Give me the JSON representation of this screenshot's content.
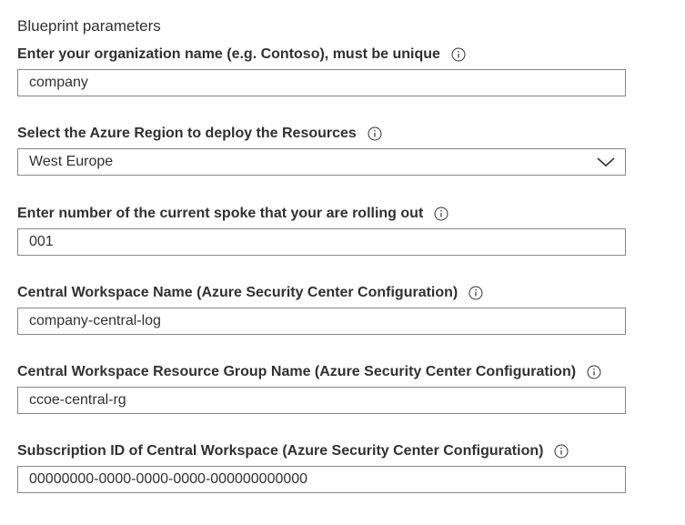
{
  "section": {
    "title": "Blueprint parameters"
  },
  "fields": [
    {
      "label": "Enter your organization name (e.g. Contoso), must be unique",
      "value": "company",
      "kind": "text"
    },
    {
      "label": "Select the Azure Region to deploy the Resources",
      "value": "West Europe",
      "kind": "dropdown"
    },
    {
      "label": "Enter number of the current spoke that your are rolling out",
      "value": "001",
      "kind": "text"
    },
    {
      "label": "Central Workspace Name (Azure Security Center Configuration)",
      "value": "company-central-log",
      "kind": "text"
    },
    {
      "label": "Central Workspace Resource Group Name (Azure Security Center Configuration)",
      "value": "ccoe-central-rg",
      "kind": "text"
    },
    {
      "label": "Subscription ID of Central Workspace (Azure Security Center Configuration)",
      "value": "00000000-0000-0000-0000-000000000000",
      "kind": "text"
    }
  ],
  "icons": {
    "info": "info-icon",
    "dropdown": "chevron-down-icon"
  },
  "colors": {
    "text": "#323130",
    "border": "#8a8886",
    "background": "#ffffff"
  }
}
